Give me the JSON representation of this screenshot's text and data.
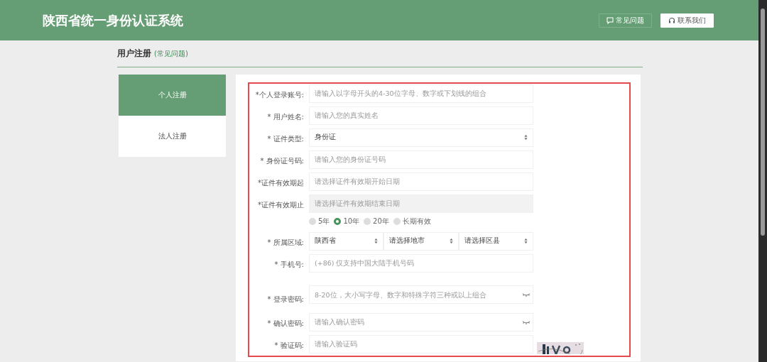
{
  "header": {
    "title": "陕西省统一身份认证系统",
    "buttons": [
      {
        "label": "常见问题",
        "kind": "faq"
      },
      {
        "label": "联系我们",
        "kind": "contact"
      }
    ]
  },
  "page": {
    "title": "用户注册",
    "link": "(常见问题)"
  },
  "tabs": [
    {
      "label": "个人注册",
      "selected": true
    },
    {
      "label": "法人注册",
      "selected": false
    }
  ],
  "form": {
    "fields": [
      {
        "kind": "text",
        "label": "*个人登录账号:",
        "placeholder": "请输入以字母开头的4-30位字母、数字或下划线的组合",
        "disabled": false
      },
      {
        "kind": "text",
        "label": "* 用户姓名:",
        "placeholder": "请输入您的真实姓名",
        "disabled": false
      },
      {
        "kind": "select",
        "label": "* 证件类型:",
        "value": "身份证"
      },
      {
        "kind": "text",
        "label": "* 身份证号码:",
        "placeholder": "请输入您的身份证号码",
        "disabled": false
      },
      {
        "kind": "text",
        "label": "*证件有效期起",
        "placeholder": "请选择证件有效期开始日期",
        "disabled": false
      },
      {
        "kind": "text",
        "label": "*证件有效期止",
        "placeholder": "请选择证件有效期结束日期",
        "disabled": true
      },
      {
        "kind": "radio",
        "options": [
          {
            "label": "5年",
            "selected": false
          },
          {
            "label": "10年",
            "selected": true
          },
          {
            "label": "20年",
            "selected": false
          },
          {
            "label": "长期有效",
            "selected": false
          }
        ]
      },
      {
        "kind": "region",
        "label": "* 所属区域:",
        "values": [
          "陕西省",
          "请选择地市",
          "请选择区县"
        ]
      },
      {
        "kind": "text",
        "label": "* 手机号:",
        "placeholder": "(+86) 仅支持中国大陆手机号码",
        "disabled": false
      },
      {
        "kind": "password",
        "label": "* 登录密码:",
        "placeholder": "8-20位，大小写字母、数字和特殊字符三种或以上组合",
        "tall": true
      },
      {
        "kind": "password",
        "label": "* 确认密码:",
        "placeholder": "请输入确认密码",
        "tall": false
      },
      {
        "kind": "captcha",
        "label": "* 验证码:",
        "placeholder": "请输入验证码"
      }
    ]
  }
}
